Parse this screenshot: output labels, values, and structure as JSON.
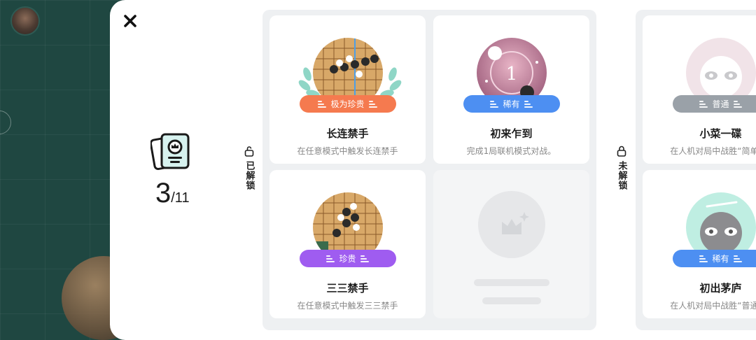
{
  "summary": {
    "unlocked": "3",
    "total": "/11"
  },
  "sections": {
    "unlocked_label": "已解锁",
    "locked_label": "未解锁"
  },
  "cards": [
    {
      "title": "长连禁手",
      "desc": "在任意模式中触发长连禁手",
      "badge": "极为珍贵",
      "badge_color": "#f57a4f",
      "icon": "gomoku-board-five-in-row-medal"
    },
    {
      "title": "初来乍到",
      "desc": "完成1局联机模式对战。",
      "badge": "稀有",
      "badge_color": "#4d8ff2",
      "icon": "pink-number-one-medal"
    },
    {
      "title": "三三禁手",
      "desc": "在任意模式中触发三三禁手",
      "badge": "珍贵",
      "badge_color": "#9f5cf0",
      "icon": "gomoku-board-three-three-medal"
    },
    {
      "title": "小菜一碟",
      "desc": "在人机对局中战胜“简单”难",
      "badge": "普通",
      "badge_color": "#9aa1a8",
      "icon": "grey-face-medal"
    },
    {
      "title": "初出茅庐",
      "desc": "在人机对局中战胜“普通”难",
      "badge": "稀有",
      "badge_color": "#4d8ff2",
      "icon": "mint-face-medal"
    }
  ],
  "colors": {
    "panel": "#ffffff",
    "group_bg": "#eef0f2",
    "background": "#1f4741"
  }
}
